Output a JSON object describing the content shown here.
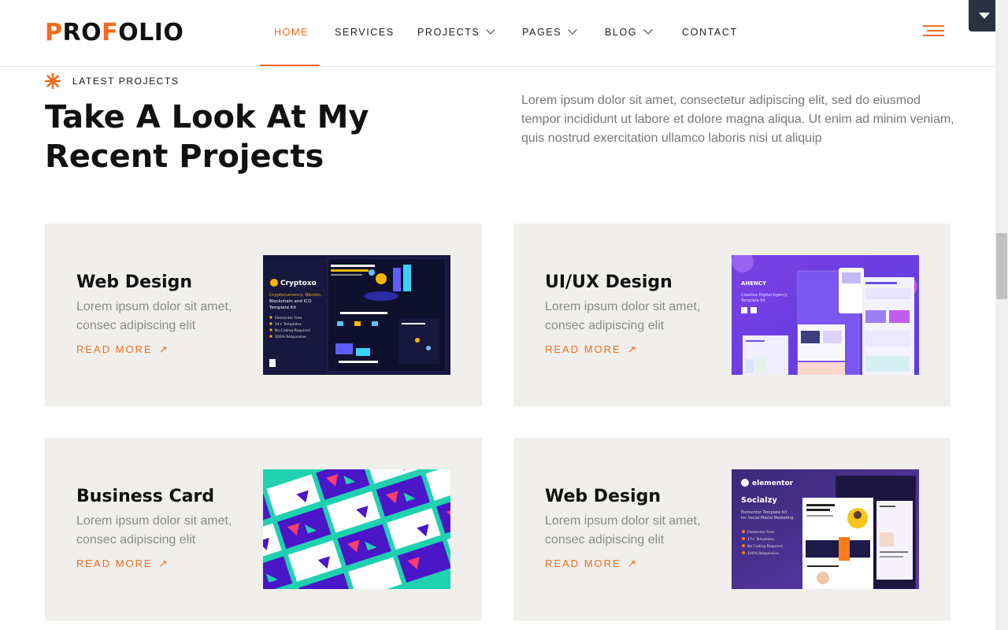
{
  "brand": {
    "logo_a": "P",
    "logo_b": "RO",
    "logo_c": "F",
    "logo_d": "OLIO",
    "accent": "#f26b1d"
  },
  "nav": {
    "items": [
      {
        "label": "HOME",
        "active": true
      },
      {
        "label": "SERVICES"
      },
      {
        "label": "PROJECTS"
      },
      {
        "label": "PAGES"
      },
      {
        "label": "BLOG"
      },
      {
        "label": "CONTACT"
      }
    ]
  },
  "section": {
    "eyebrow": "LATEST PROJECTS",
    "title_line1": "Take A Look At My",
    "title_line2": "Recent Projects",
    "description": "Lorem ipsum dolor sit amet, consectetur adipiscing elit, sed do eiusmod tempor incididunt ut labore et dolore magna aliqua. Ut enim ad minim veniam, quis nostrud exercitation ullamco laboris nisi ut aliquip"
  },
  "projects": [
    {
      "title": "Web Design",
      "desc": "Lorem ipsum dolor sit amet, consec adipiscing elit",
      "link": "READ MORE",
      "thumb": {
        "brand": "Cryptoxo",
        "line1": "Cryptocurrency, Bitcoin,",
        "line2": "Blockchain and ICO",
        "line3": "Template Kit",
        "bullets": [
          "Elementor Free",
          "14+ Templates",
          "No Coding Required",
          "100% Responsive"
        ]
      }
    },
    {
      "title": "UI/UX Design",
      "desc": "Lorem ipsum dolor sit amet, consec adipiscing elit",
      "link": "READ MORE",
      "thumb": {
        "brand": "AHENCY",
        "line1": "Creative Digital Agency",
        "line2": "Template Kit"
      }
    },
    {
      "title": "Business Card",
      "desc": "Lorem ipsum dolor sit amet, consec adipiscing elit",
      "link": "READ MORE",
      "thumb": {}
    },
    {
      "title": "Web Design",
      "desc": "Lorem ipsum dolor sit amet, consec adipiscing elit",
      "link": "READ MORE",
      "thumb": {
        "brand": "elementor",
        "product": "Socialzy",
        "line1": "Elementor Template Kit",
        "line2": "for Social Media Marketing",
        "bullets": [
          "Elementor Free",
          "17+ Templates",
          "No Coding Required",
          "100% Responsive"
        ]
      }
    }
  ]
}
